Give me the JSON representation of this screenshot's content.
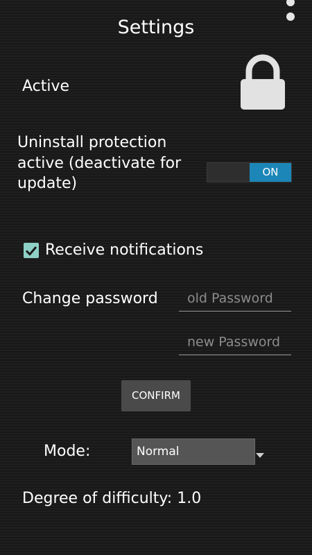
{
  "header": {
    "title": "Settings",
    "menu_icon": "overflow-menu-icon"
  },
  "active": {
    "label": "Active",
    "icon": "lock-icon"
  },
  "uninstall": {
    "label": "Uninstall protection active (deactivate for update)",
    "toggle_label": "ON"
  },
  "notifications": {
    "label": "Receive notifications",
    "checked": true
  },
  "password": {
    "label": "Change password",
    "old_placeholder": "old Password",
    "new_placeholder": "new Password",
    "confirm_label": "CONFIRM"
  },
  "mode": {
    "label": "Mode:",
    "selected": "Normal"
  },
  "difficulty": {
    "label": "Degree of difficulty: 1.0"
  },
  "colors": {
    "background": "#1b1b1b",
    "toggle_on": "#1c86b8",
    "checkbox": "#8fd0c6",
    "button": "#4a4a4a"
  }
}
